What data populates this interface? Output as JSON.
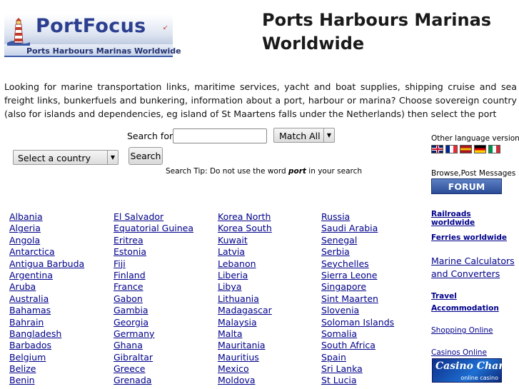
{
  "logo": {
    "title": "PortFocus",
    "subtitle": "Ports Harbours Marinas Worldwide"
  },
  "page_title": "Ports Harbours Marinas Worldwide",
  "intro": "Looking for marine transportation links, maritime services, yacht and boat supplies, shipping cruise and sea freight links, bunkerfuels and bunkering, information about a port, harbour or marina? Choose sovereign country (also for islands and dependencies, eg island of St Maartens falls under the Netherlands) then select the port",
  "search": {
    "label": "Search for:",
    "value": "",
    "match_selected": "Match All",
    "country_selected": "Select a country",
    "button": "Search",
    "tip_prefix": "Search Tip: Do not use the word",
    "tip_word": "port",
    "tip_suffix": "in your search"
  },
  "countries": {
    "col1": [
      "Albania",
      "Algeria",
      "Angola",
      "Antarctica",
      "Antigua Barbuda",
      "Argentina",
      "Aruba",
      "Australia",
      "Bahamas",
      "Bahrain",
      "Bangladesh",
      "Barbados",
      "Belgium",
      "Belize",
      "Benin"
    ],
    "col2": [
      "El Salvador",
      "Equatorial Guinea",
      "Eritrea",
      "Estonia",
      "Fiji",
      "Finland",
      "France",
      "Gabon",
      "Gambia",
      "Georgia",
      "Germany",
      "Ghana",
      "Gibraltar",
      "Greece",
      "Grenada"
    ],
    "col3": [
      "Korea North",
      "Korea South",
      "Kuwait",
      "Latvia",
      "Lebanon",
      "Liberia",
      "Libya",
      "Lithuania",
      "Madagascar",
      "Malaysia",
      "Malta",
      "Mauritania",
      "Mauritius",
      "Mexico",
      "Moldova"
    ],
    "col4": [
      "Russia",
      "Saudi Arabia",
      "Senegal",
      "Serbia",
      "Seychelles",
      "Sierra Leone",
      "Singapore",
      "Sint Maarten",
      "Slovenia",
      "Soloman Islands",
      "Somalia",
      "South Africa",
      "Spain",
      "Sri Lanka",
      "St Lucia"
    ]
  },
  "right_panel": {
    "language_label": "Other language versions",
    "flags": [
      {
        "name": "uk-flag-icon",
        "colors": [
          "#012169",
          "#ffffff",
          "#c8102e"
        ]
      },
      {
        "name": "france-flag-icon",
        "colors": [
          "#002395",
          "#ffffff",
          "#ed2939"
        ]
      },
      {
        "name": "spain-flag-icon",
        "colors": [
          "#aa151b",
          "#f1bf00",
          "#aa151b"
        ]
      },
      {
        "name": "germany-flag-icon",
        "colors": [
          "#000000",
          "#dd0000",
          "#ffce00"
        ]
      },
      {
        "name": "italy-flag-icon",
        "colors": [
          "#009246",
          "#ffffff",
          "#ce2b37"
        ]
      }
    ],
    "browse_label": "Browse,Post Messages",
    "forum": "FORUM",
    "railroads": "Railroads worldwide",
    "ferries": "Ferries worldwide",
    "calculators_line1": "Marine Calculators",
    "calculators_line2": "and Converters",
    "travel_line1": "Travel",
    "travel_line2": "Accommodation",
    "shopping": "Shopping Online",
    "casinos": "Casinos Online",
    "casino_banner_title": "Casino Chance",
    "casino_banner_sub": "online casino"
  },
  "colors": {
    "link": "#00008b",
    "logo_blue": "#2c3f8f",
    "forum_button": "#3b5da8"
  }
}
